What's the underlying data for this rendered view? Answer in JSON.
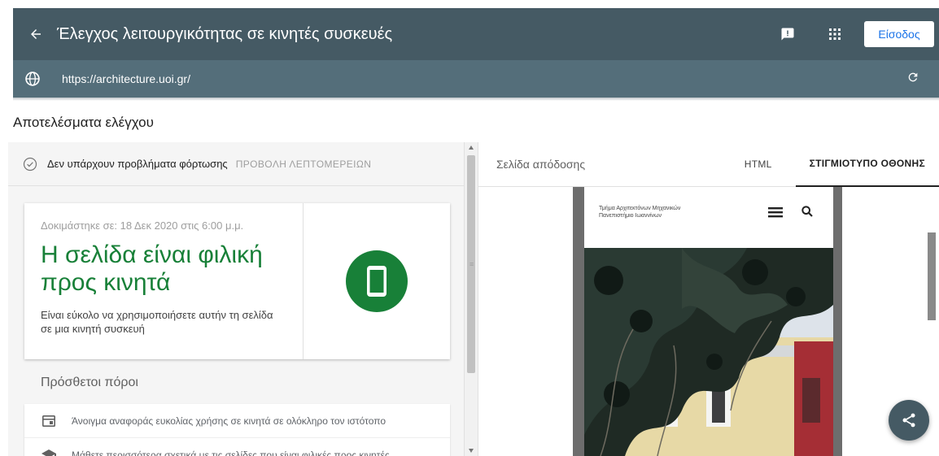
{
  "header": {
    "title": "Έλεγχος λειτουργικότητας σε κινητές συσκευές",
    "back_icon": "arrow-back-icon",
    "feedback_icon": "feedback-icon",
    "apps_icon": "apps-grid-icon",
    "login_label": "Είσοδος"
  },
  "urlbar": {
    "url": "https://architecture.uoi.gr/",
    "globe_icon": "globe-icon",
    "reload_icon": "reload-icon"
  },
  "results": {
    "title": "Αποτελέσματα ελέγχου"
  },
  "status": {
    "text": "Δεν υπάρχουν προβλήματα φόρτωσης",
    "details_link": "ΠΡΟΒΟΛΗ ΛΕΠΤΟΜΕΡΕΙΩΝ"
  },
  "card": {
    "tested": "Δοκιμάστηκε σε: 18 Δεκ 2020 στις 6:00 μ.μ.",
    "headline": "Η σελίδα είναι φιλική προς κινητά",
    "subtitle": "Είναι εύκολο να χρησιμοποιήσετε αυτήν τη σελίδα σε μια κινητή συσκευή",
    "accent": "#188038"
  },
  "resources": {
    "title": "Πρόσθετοι πόροι",
    "items": [
      {
        "icon": "report-icon",
        "text": "Άνοιγμα αναφοράς ευκολίας χρήσης σε κινητά σε ολόκληρο τον ιστότοπο"
      },
      {
        "icon": "school-icon",
        "text": "Μάθετε περισσότερα σχετικά με τις σελίδες που είναι φιλικές προς κινητές"
      }
    ]
  },
  "preview": {
    "rendered_label": "Σελίδα απόδοσης",
    "tabs": [
      {
        "label": "HTML",
        "active": false
      },
      {
        "label": "ΣΤΙΓΜΙΟΤΥΠΟ ΟΘΟΝΗΣ",
        "active": true
      }
    ],
    "site_name_line1": "Τμήμα Αρχιτεκτόνων Μηχανικών",
    "site_name_line2": "Πανεπιστήμιο Ιωαννίνων"
  },
  "fab": {
    "icon": "share-icon"
  },
  "colors": {
    "header_bg": "#455a64",
    "urlbar_bg": "#546e7a",
    "primary_blue": "#1a73e8",
    "success_green": "#188038"
  }
}
